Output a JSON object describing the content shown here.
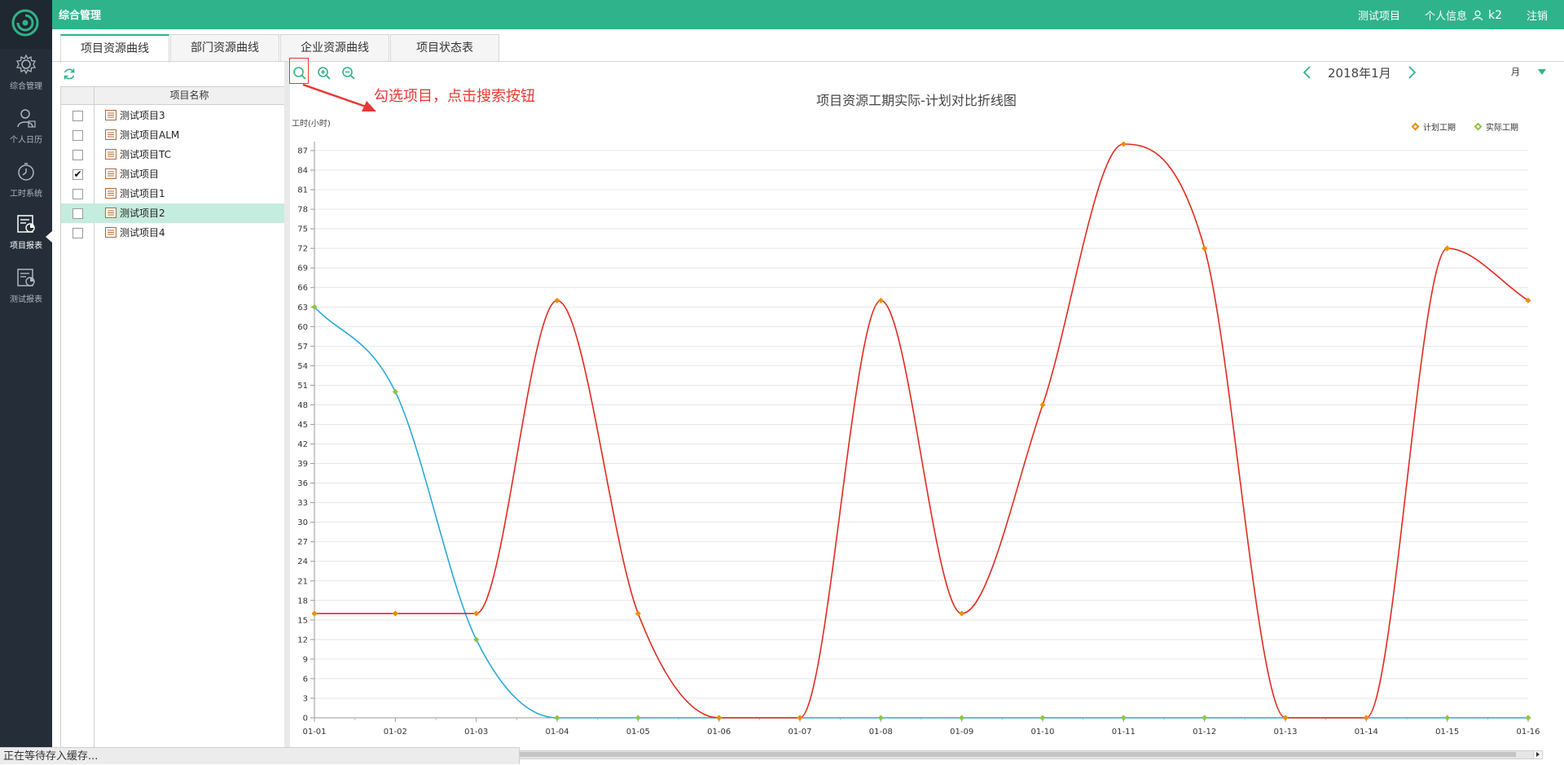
{
  "header": {
    "app_title": "综合管理",
    "project_link": "测试项目",
    "personal_info": "个人信息",
    "username": "k2",
    "logout": "注销"
  },
  "sidebar": {
    "items": [
      {
        "label": "综合管理",
        "icon": "gear-icon"
      },
      {
        "label": "个人日历",
        "icon": "person-icon"
      },
      {
        "label": "工时系统",
        "icon": "stopwatch-icon"
      },
      {
        "label": "项目报表",
        "icon": "report-icon",
        "active": true
      },
      {
        "label": "测试报表",
        "icon": "report-icon"
      }
    ]
  },
  "tabs": [
    {
      "label": "项目资源曲线",
      "active": true
    },
    {
      "label": "部门资源曲线"
    },
    {
      "label": "企业资源曲线"
    },
    {
      "label": "项目状态表"
    }
  ],
  "tree": {
    "header": "项目名称",
    "rows": [
      {
        "name": "测试项目3",
        "checked": false,
        "selected": false
      },
      {
        "name": "测试项目ALM",
        "checked": false,
        "selected": false
      },
      {
        "name": "测试项目TC",
        "checked": false,
        "selected": false
      },
      {
        "name": "测试项目",
        "checked": true,
        "selected": false
      },
      {
        "name": "测试项目1",
        "checked": false,
        "selected": false
      },
      {
        "name": "测试项目2",
        "checked": false,
        "selected": true
      },
      {
        "name": "测试项目4",
        "checked": false,
        "selected": false
      }
    ]
  },
  "annotation": "勾选项目，点击搜索按钮",
  "date_nav": {
    "label": "2018年1月"
  },
  "period_select": {
    "value": "月"
  },
  "colors": {
    "accent": "#2fb38a",
    "plan": "#e02b20",
    "actual": "#2aa8d6",
    "plan_marker": "#f08c00",
    "actual_marker": "#8cc540"
  },
  "chart_data": {
    "type": "line",
    "title": "项目资源工期实际-计划对比折线图",
    "ylabel": "工时(小时)",
    "categories": [
      "01-01",
      "01-02",
      "01-03",
      "01-04",
      "01-05",
      "01-06",
      "01-07",
      "01-08",
      "01-09",
      "01-10",
      "01-11",
      "01-12",
      "01-13",
      "01-14",
      "01-15",
      "01-16"
    ],
    "ylim": [
      0,
      87
    ],
    "yticks": [
      0,
      3,
      6,
      9,
      12,
      15,
      18,
      21,
      24,
      27,
      30,
      33,
      36,
      39,
      42,
      45,
      48,
      51,
      54,
      57,
      60,
      63,
      66,
      69,
      72,
      75,
      78,
      81,
      84,
      87
    ],
    "series": [
      {
        "name": "计划工期",
        "values": [
          16,
          16,
          16,
          64,
          16,
          0,
          0,
          64,
          16,
          48,
          88,
          72,
          0,
          0,
          72,
          64
        ]
      },
      {
        "name": "实际工期",
        "values": [
          63,
          50,
          12,
          0,
          0,
          0,
          0,
          0,
          0,
          0,
          0,
          0,
          0,
          0,
          0,
          0
        ]
      }
    ],
    "legend": "top-right",
    "grid": true
  },
  "status": {
    "text": "正在等待存入缓存..."
  }
}
